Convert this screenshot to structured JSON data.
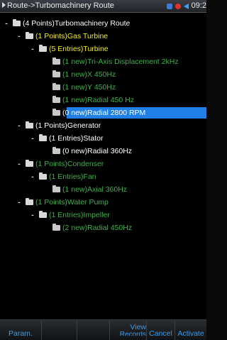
{
  "titlebar": {
    "title": "Route->Turbomachinery Route",
    "time": "09:2"
  },
  "tree": [
    {
      "label": "(4 Points)Turbomachinery Route",
      "color": "#ffffff",
      "indent": 18,
      "minus": true,
      "folder": "#d9d9d9"
    },
    {
      "label": "(1 Points)Gas Turbine",
      "color": "#f5f000",
      "indent": 36,
      "minus": true,
      "folder": "#d9d9d9"
    },
    {
      "label": "(5 Entries)Turbine",
      "color": "#f5f000",
      "indent": 55,
      "minus": true,
      "folder": "#d9d9d9"
    },
    {
      "label": "(1 new)Tri-Axis Displacement 2kHz",
      "color": "#3bb24a",
      "indent": 74,
      "minus": false,
      "folder": "#c8c8c8"
    },
    {
      "label": "(1 new)X 450Hz",
      "color": "#3bb24a",
      "indent": 74,
      "minus": false,
      "folder": "#c8c8c8"
    },
    {
      "label": "(1 new)Y 450Hz",
      "color": "#3bb24a",
      "indent": 74,
      "minus": false,
      "folder": "#c8c8c8"
    },
    {
      "label": "(1 new)Radial 450 Hz",
      "color": "#3bb24a",
      "indent": 74,
      "minus": false,
      "folder": "#c8c8c8"
    },
    {
      "label": "(0 new)Radial 2800 RPM",
      "color": "#ffffff",
      "indent": 74,
      "minus": false,
      "folder": "#c8c8c8",
      "selected": true
    },
    {
      "label": "(1 Points)Generator",
      "color": "#ffffff",
      "indent": 36,
      "minus": true,
      "folder": "#d9d9d9"
    },
    {
      "label": "(1 Entries)Stator",
      "color": "#ffffff",
      "indent": 55,
      "minus": true,
      "folder": "#d9d9d9"
    },
    {
      "label": "(0 new)Radial 360Hz",
      "color": "#ffffff",
      "indent": 74,
      "minus": false,
      "folder": "#c8c8c8"
    },
    {
      "label": "(1 Points)Condenser",
      "color": "#3bb24a",
      "indent": 36,
      "minus": true,
      "folder": "#d9d9d9"
    },
    {
      "label": "(1 Entries)Fan",
      "color": "#3bb24a",
      "indent": 55,
      "minus": true,
      "folder": "#d9d9d9"
    },
    {
      "label": "(1 new)Axial 360Hz",
      "color": "#3bb24a",
      "indent": 74,
      "minus": false,
      "folder": "#c8c8c8"
    },
    {
      "label": "(1 Points)Water Pump",
      "color": "#3bb24a",
      "indent": 36,
      "minus": true,
      "folder": "#d9d9d9"
    },
    {
      "label": "(1 Entries)Impeller",
      "color": "#3bb24a",
      "indent": 55,
      "minus": true,
      "folder": "#d9d9d9"
    },
    {
      "label": "(2 new)Radial 450Hz",
      "color": "#3bb24a",
      "indent": 74,
      "minus": false,
      "folder": "#c8c8c8"
    }
  ],
  "footer": {
    "param": "Param.",
    "view_records_1": "View",
    "view_records_2": "Records",
    "cancel": "Cancel",
    "activate": "Activate"
  }
}
